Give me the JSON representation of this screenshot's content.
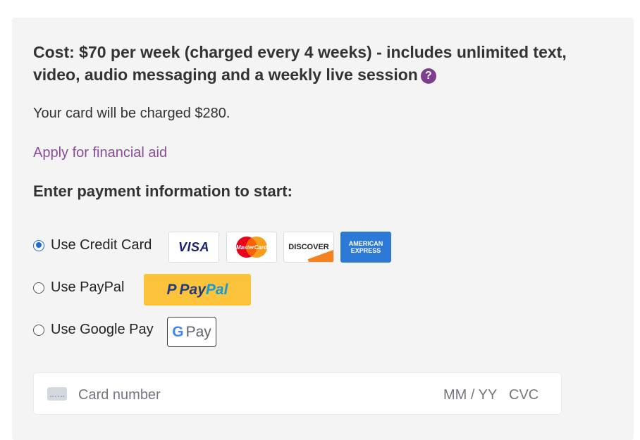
{
  "cost": {
    "text": "Cost: $70 per week (charged every 4 weeks) - includes unlimited text, video, audio messaging and a weekly live session",
    "help_icon": "question-circle-icon"
  },
  "charge_text": "Your card will be charged $280.",
  "financial_aid_link": "Apply for financial aid",
  "payment_heading": "Enter payment information to start:",
  "payment_options": [
    {
      "label": "Use Credit Card",
      "selected": true
    },
    {
      "label": "Use PayPal",
      "selected": false
    },
    {
      "label": "Use Google Pay",
      "selected": false
    }
  ],
  "card_logos": {
    "visa": "VISA",
    "mastercard": "MasterCard",
    "discover": "DISCOVER",
    "amex_line1": "AMERICAN",
    "amex_line2": "EXPRESS"
  },
  "paypal_button": {
    "p": "Pay",
    "pal": "Pal"
  },
  "gpay_button": {
    "g": "G",
    "pay": "Pay"
  },
  "card_form": {
    "card_placeholder": "Card number",
    "expiry_placeholder": "MM / YY",
    "cvc_placeholder": "CVC"
  },
  "colors": {
    "accent_purple": "#8a4c96",
    "radio_blue": "#1f6ad4",
    "paypal_yellow": "#fcc33b"
  }
}
